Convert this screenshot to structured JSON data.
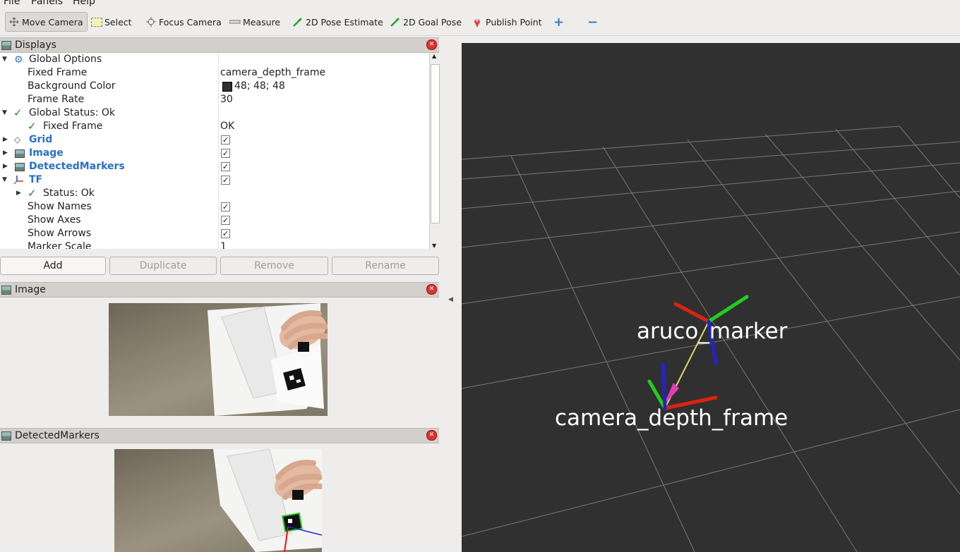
{
  "menu": {
    "file": "File",
    "panels": "Panels",
    "help": "Help"
  },
  "toolbar": {
    "move_camera": "Move Camera",
    "select": "Select",
    "focus_camera": "Focus Camera",
    "measure": "Measure",
    "pose_estimate": "2D Pose Estimate",
    "goal_pose": "2D Goal Pose",
    "publish_point": "Publish Point"
  },
  "displays": {
    "title": "Displays",
    "rows": {
      "global_options": "Global Options",
      "fixed_frame": "Fixed Frame",
      "fixed_frame_value": "camera_depth_frame",
      "background_color": "Background Color",
      "background_color_value": "48; 48; 48",
      "frame_rate": "Frame Rate",
      "frame_rate_value": "30",
      "global_status": "Global Status: Ok",
      "fixed_frame_status": "Fixed Frame",
      "fixed_frame_status_value": "OK",
      "grid": "Grid",
      "image": "Image",
      "detected_markers": "DetectedMarkers",
      "tf": "TF",
      "status_ok": "Status: Ok",
      "show_names": "Show Names",
      "show_axes": "Show Axes",
      "show_arrows": "Show Arrows",
      "marker_scale": "Marker Scale",
      "marker_scale_value": "1"
    }
  },
  "buttons": {
    "add": "Add",
    "duplicate": "Duplicate",
    "remove": "Remove",
    "rename": "Rename"
  },
  "image_panel": {
    "title": "Image"
  },
  "markers_panel": {
    "title": "DetectedMarkers"
  },
  "viewport": {
    "background": "#303030",
    "labels": {
      "aruco": "aruco_marker",
      "camera": "camera_depth_frame"
    }
  }
}
